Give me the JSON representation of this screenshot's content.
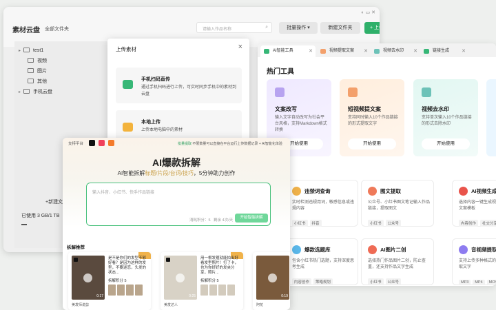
{
  "cloud": {
    "title": "素材云盘",
    "crumb": "全部文件夹",
    "search_placeholder": "请输入作品名称",
    "batch_label": "批量操作",
    "new_folder_label": "新建文件夹",
    "upload_label": "+ 上传素材",
    "tree": [
      "test1",
      "视频",
      "图片",
      "其他",
      "手机云盘"
    ],
    "new_folder_link": "+新建文件",
    "usage": "已使用 3 GB/1 TB"
  },
  "upload": {
    "title": "上传素材",
    "options": [
      {
        "title": "手机扫码直传",
        "desc": "通过手机扫码进行上传，可实时同步手机中的素材到云盘"
      },
      {
        "title": "本地上传",
        "desc": "上传本地电脑中的素材"
      }
    ]
  },
  "tools": {
    "tabs": [
      "AI智能工具",
      "视频提取文案",
      "视频去水印",
      "链接生成"
    ],
    "hot_title": "热门工具",
    "featured": [
      {
        "title": "文案改写",
        "desc": "输入文字自动改写为社会平台风格，支持Markdown格式转换",
        "btn": "开始使用",
        "color": "#b7a3f0"
      },
      {
        "title": "短视频提文案",
        "desc": "支持同时输入10个作品链接的形式提取文字",
        "btn": "开始使用",
        "color": "#f3a06b"
      },
      {
        "title": "视频去水印",
        "desc": "支持单次输入10个作品链接的形式去除水印",
        "btn": "开始使用",
        "color": "#6dc2b8"
      }
    ],
    "cards": [
      {
        "title": "违禁词查询",
        "desc": "实时检测违规用词，敏感信息或违规内容",
        "tags": [
          "小红书",
          "抖音"
        ],
        "color": "#f0b24a"
      },
      {
        "title": "图文提取",
        "desc": "公众号、小红书图文笔记输入作品链接，提取图文",
        "tags": [
          "小红书",
          "公众号"
        ],
        "color": "#ef7a5a"
      },
      {
        "title": "AI视频生成",
        "desc": "选择内容一键生成视频，支持输入文案模板",
        "tags": [
          "内容创作",
          "社交分享"
        ],
        "color": "#e9544b"
      },
      {
        "title": "爆款选题库",
        "desc": "包含小红书热门选题，支持深度思考生成",
        "tags": [
          "内容创作",
          "策略规划"
        ],
        "color": "#5bb8ea"
      },
      {
        "title": "AI图片二创",
        "desc": "选择热门作品图片二创，防止查重，还支持作品文字生成",
        "tags": [
          "小红书",
          "公众号"
        ],
        "color": "#ef6b55"
      },
      {
        "title": "音视频提取",
        "desc": "支持上传多种格式的音视频文件提取文字",
        "tags": [
          "MP3",
          "MP4",
          "MOV"
        ],
        "color": "#8e7cf0"
      }
    ]
  },
  "ai": {
    "platforms_label": "支持平台",
    "notice_prefix": "批量提取",
    "notice": "不限数量可以直接在平台运行上传数据记录",
    "notice_suffix": "+ AI智能化体验",
    "title": "AI爆款拆解",
    "subtitle_prefix": "AI智能拆解",
    "subtitle_highlight": "标题/片段/台词/技巧",
    "subtitle_suffix": "，5分钟助力创作",
    "input_placeholder": "输入抖音、小红书、快手作品链接",
    "limit_text": "消耗积分：5",
    "count_text": "剩余 4次/天",
    "go_label": "开始智能拆解",
    "rec_title": "拆解推荐",
    "videos": [
      {
        "text": "是不是你们的发型不够好看？是因为这样的发型，不要迷恋，头发的状态...",
        "score": "拆解积分 5",
        "duration": "0:17",
        "author": "美发师说剪"
      },
      {
        "text": "用一根发箍就能拍出好看发型照片！打了卡，也为你好好的发夹分享，照片...",
        "score": "拆解积分 5",
        "duration": "0:25",
        "author": "美发达人"
      },
      {
        "text": "别再绑这种低马尾了，你跟着我这样绑，显脸小还高级！",
        "score": "拆解积分 5",
        "duration": "0:19",
        "author": "阿花"
      }
    ]
  }
}
